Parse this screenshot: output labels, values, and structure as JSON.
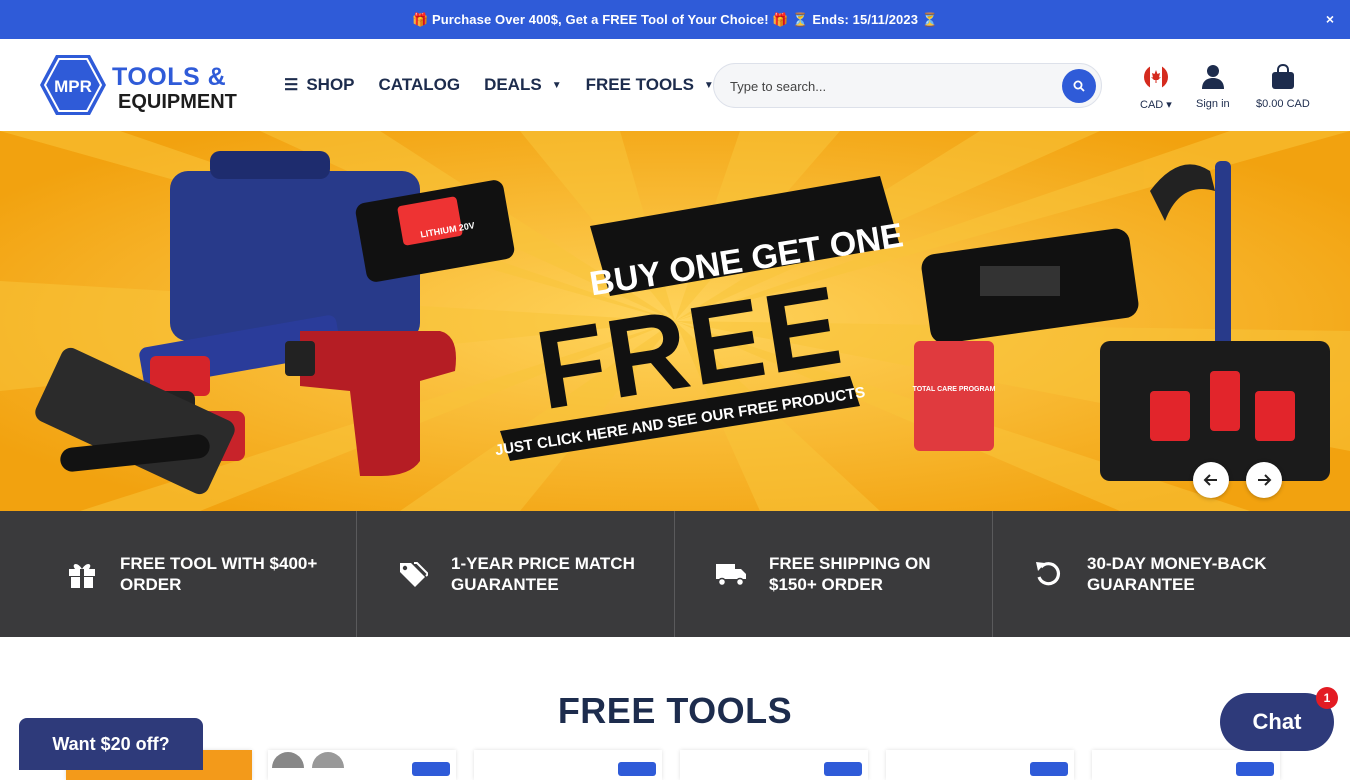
{
  "announcement": {
    "text": "🎁 Purchase Over 400$, Get a FREE Tool of Your Choice! 🎁   ⏳ Ends: 15/11/2023 ⏳",
    "close_symbol": "×"
  },
  "header": {
    "logo": {
      "mpr": "MPR",
      "line1": "TOOLS &",
      "line2": "EQUIPMENT"
    },
    "nav": [
      {
        "label": "SHOP",
        "icon": "menu-icon"
      },
      {
        "label": "CATALOG"
      },
      {
        "label": "DEALS",
        "icon": "chevron-down-icon"
      },
      {
        "label": "FREE TOOLS",
        "icon": "chevron-down-icon"
      }
    ],
    "search": {
      "placeholder": "Type to search..."
    },
    "currency": {
      "label": "CAD",
      "icon": "canada-flag-icon"
    },
    "account": {
      "label": "Sign in",
      "icon": "user-icon"
    },
    "cart": {
      "label": "$0.00 CAD",
      "icon": "shopping-bag-icon"
    }
  },
  "hero": {
    "line1": "BUY ONE GET ONE",
    "line2": "FREE",
    "line3": "JUST CLICK HERE AND SEE OUR FREE PRODUCTS",
    "battery_text": "LITHIUM 20V",
    "card_text": "TOTAL CARE PROGRAM"
  },
  "features": [
    {
      "icon": "gift-icon",
      "text": "FREE TOOL WITH $400+ ORDER"
    },
    {
      "icon": "tags-icon",
      "text": "1-YEAR PRICE MATCH GUARANTEE"
    },
    {
      "icon": "truck-icon",
      "text": "FREE SHIPPING ON $150+ ORDER"
    },
    {
      "icon": "undo-icon",
      "text": "30-DAY MONEY-BACK GUARANTEE"
    }
  ],
  "section": {
    "title": "FREE TOOLS"
  },
  "promo": {
    "label": "Want $20 off?"
  },
  "chat": {
    "label": "Chat",
    "count": "1"
  },
  "colors": {
    "brand_blue": "#2f5bd8",
    "navy": "#2e3a7a",
    "banner_yellow": "#f7b21a",
    "features_bg": "#3a3a3c"
  }
}
